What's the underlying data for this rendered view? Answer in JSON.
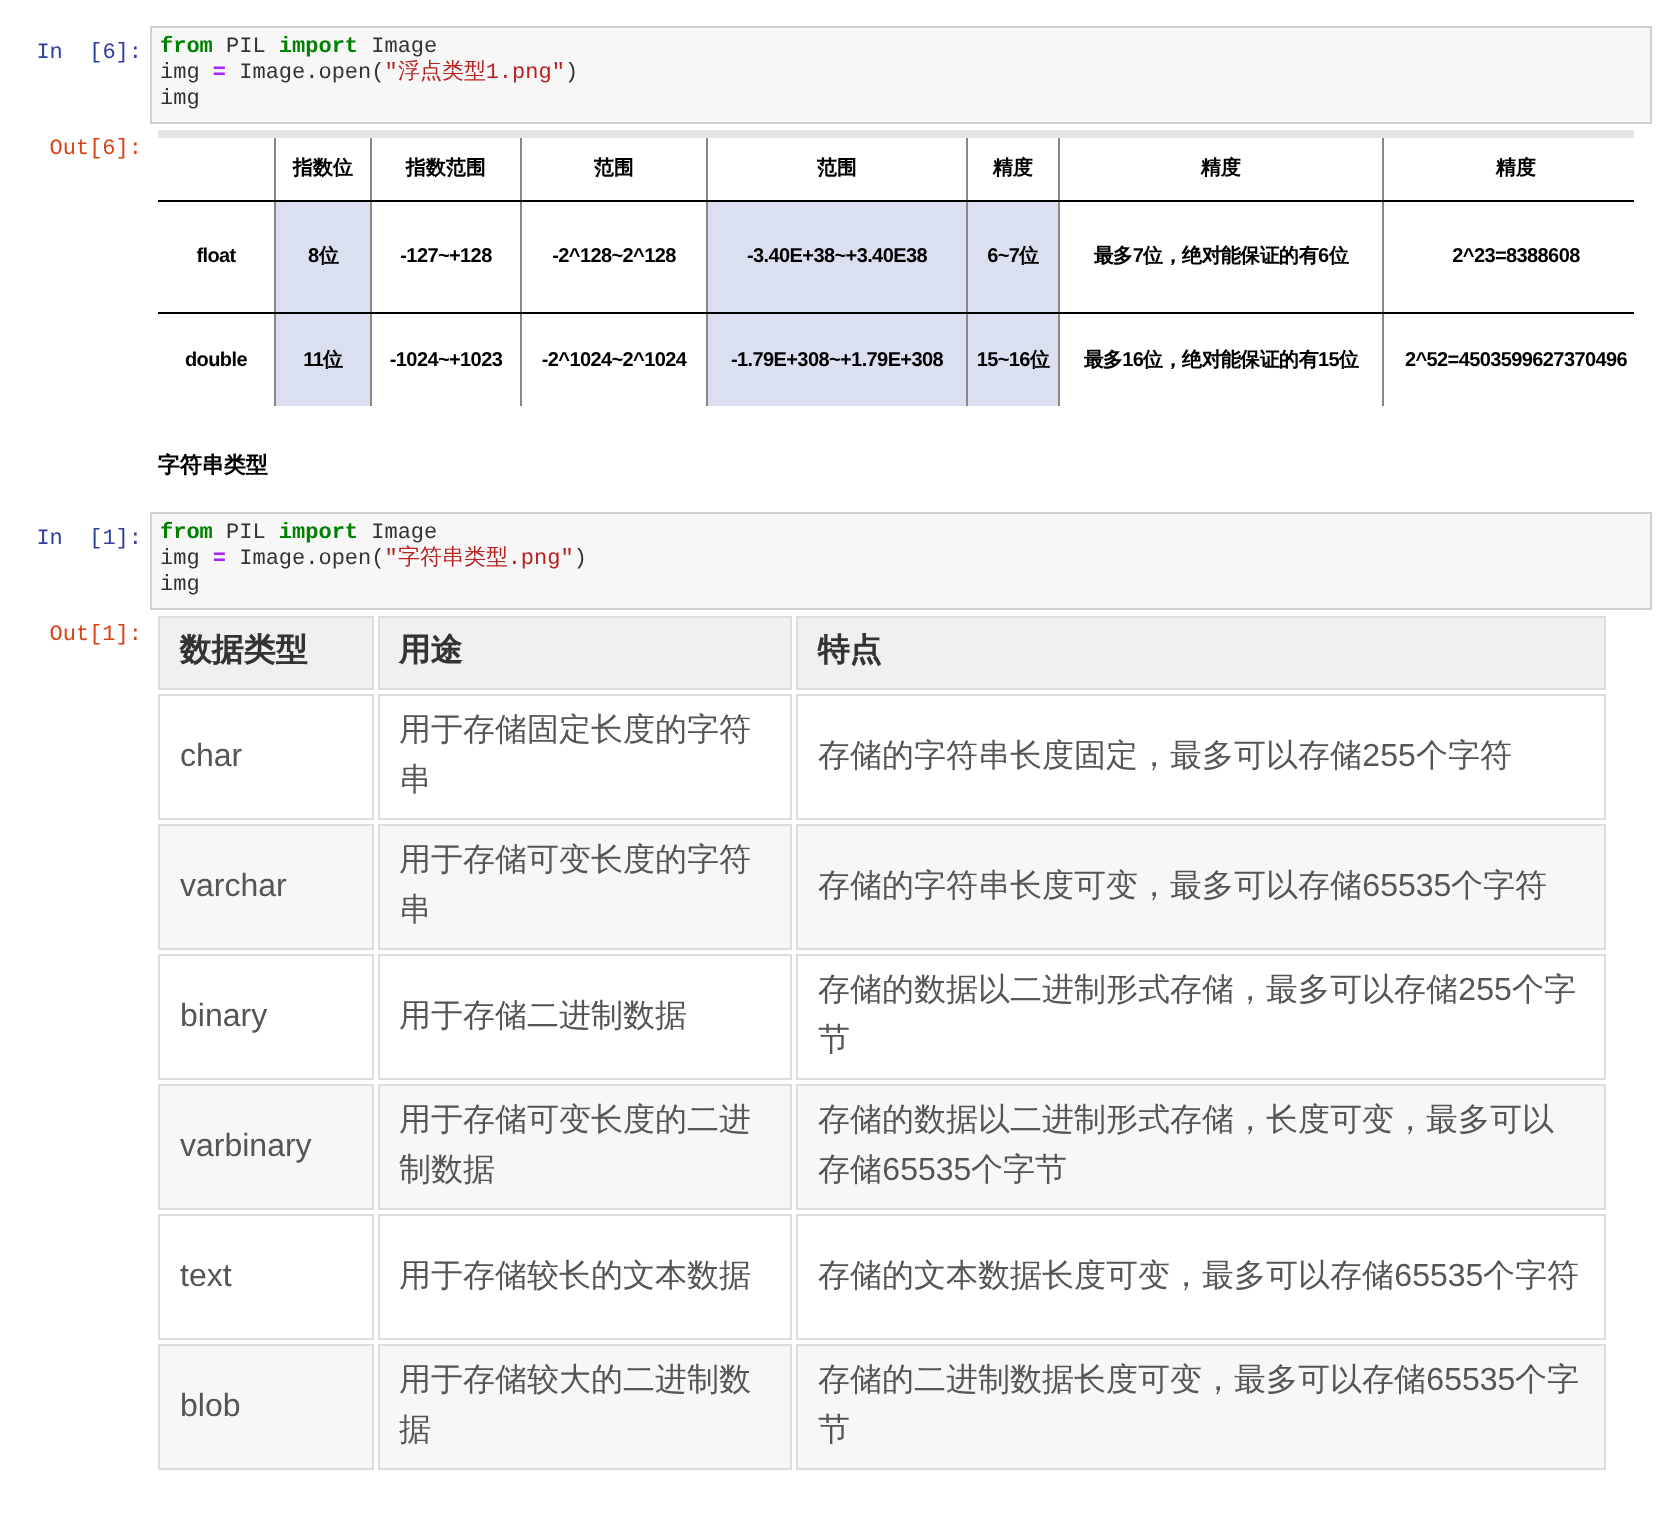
{
  "cells": [
    {
      "kind": "code",
      "prompt_in": "In  [6]:",
      "code": [
        [
          {
            "kind": "keyword",
            "text": "from"
          },
          {
            "kind": "plain",
            "text": " PIL "
          },
          {
            "kind": "keyword",
            "text": "import"
          },
          {
            "kind": "plain",
            "text": " Image"
          }
        ],
        [
          {
            "kind": "plain",
            "text": "img "
          },
          {
            "kind": "operator",
            "text": "="
          },
          {
            "kind": "plain",
            "text": " Image.open("
          },
          {
            "kind": "string",
            "text": "\"浮点类型1.png\""
          },
          {
            "kind": "plain",
            "text": ")"
          }
        ],
        [
          {
            "kind": "plain",
            "text": "img"
          }
        ]
      ],
      "prompt_out": "Out[6]:",
      "output": {
        "kind": "float_table",
        "columns": [
          {
            "highlight": false
          },
          {
            "label": "指数位",
            "highlight": true
          },
          {
            "label": "指数范围",
            "highlight": false
          },
          {
            "label": "范围",
            "highlight": false
          },
          {
            "label": "范围",
            "highlight": true
          },
          {
            "label": "精度",
            "highlight": true
          },
          {
            "label": "精度",
            "highlight": false
          },
          {
            "label": "精度",
            "highlight": false
          }
        ],
        "rows": [
          [
            "float",
            "8位",
            "-127~+128",
            "-2^128~2^128",
            "-3.40E+38~+3.40E38",
            "6~7位",
            "最多7位，绝对能保证的有6位",
            "2^23=8388608"
          ],
          [
            "double",
            "11位",
            "-1024~+1023",
            "-2^1024~2^1024",
            "-1.79E+308~+1.79E+308",
            "15~16位",
            "最多16位，绝对能保证的有15位",
            "2^52=4503599627370496"
          ]
        ]
      }
    },
    {
      "kind": "markdown",
      "heading": "字符串类型"
    },
    {
      "kind": "code",
      "prompt_in": "In  [1]:",
      "code": [
        [
          {
            "kind": "keyword",
            "text": "from"
          },
          {
            "kind": "plain",
            "text": " PIL "
          },
          {
            "kind": "keyword",
            "text": "import"
          },
          {
            "kind": "plain",
            "text": " Image"
          }
        ],
        [
          {
            "kind": "plain",
            "text": "img "
          },
          {
            "kind": "operator",
            "text": "="
          },
          {
            "kind": "plain",
            "text": " Image.open("
          },
          {
            "kind": "string",
            "text": "\"字符串类型.png\""
          },
          {
            "kind": "plain",
            "text": ")"
          }
        ],
        [
          {
            "kind": "plain",
            "text": "img"
          }
        ]
      ],
      "prompt_out": "Out[1]:",
      "output": {
        "kind": "string_table",
        "columns": [
          "数据类型",
          "用途",
          "特点"
        ],
        "rows": [
          [
            "char",
            "用于存储固定长度的字符串",
            "存储的字符串长度固定，最多可以存储255个字符"
          ],
          [
            "varchar",
            "用于存储可变长度的字符串",
            "存储的字符串长度可变，最多可以存储65535个字符"
          ],
          [
            "binary",
            "用于存储二进制数据",
            "存储的数据以二进制形式存储，最多可以存储255个字节"
          ],
          [
            "varbinary",
            "用于存储可变长度的二进制数据",
            "存储的数据以二进制形式存储，长度可变，最多可以存储65535个字节"
          ],
          [
            "text",
            "用于存储较长的文本数据",
            "存储的文本数据长度可变，最多可以存储65535个字符"
          ],
          [
            "blob",
            "用于存储较大的二进制数据",
            "存储的二进制数据长度可变，最多可以存储65535个字节"
          ]
        ]
      }
    }
  ]
}
